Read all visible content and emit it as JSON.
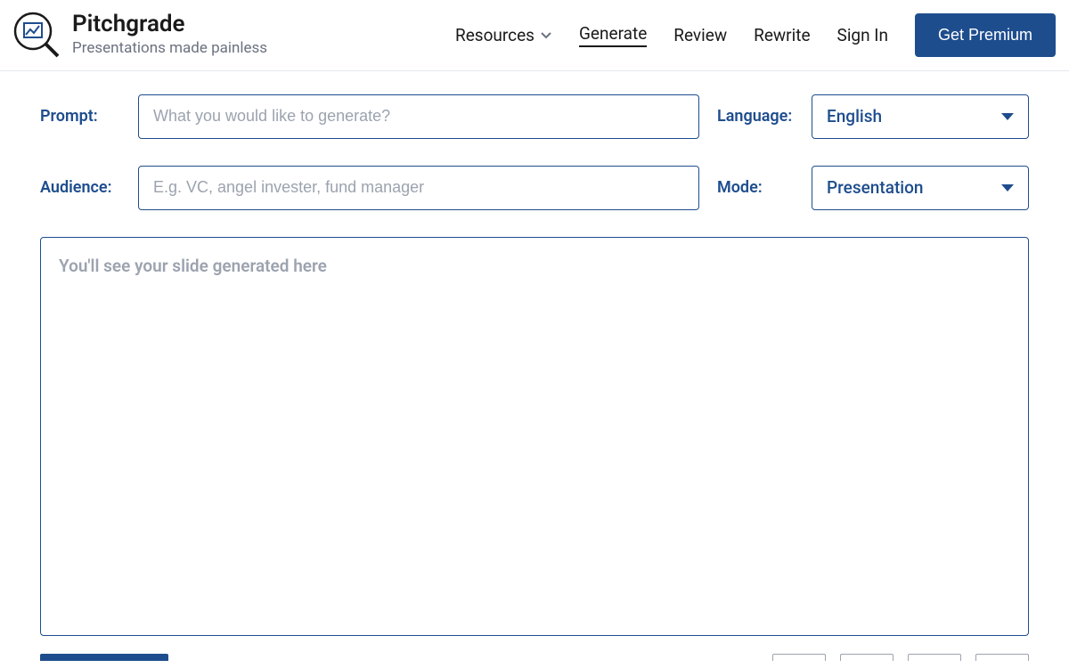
{
  "brand": {
    "title": "Pitchgrade",
    "tagline": "Presentations made painless"
  },
  "nav": {
    "resources": "Resources",
    "generate": "Generate",
    "review": "Review",
    "rewrite": "Rewrite",
    "signin": "Sign In",
    "premium": "Get Premium"
  },
  "form": {
    "prompt_label": "Prompt:",
    "prompt_placeholder": "What you would like to generate?",
    "audience_label": "Audience:",
    "audience_placeholder": "E.g. VC, angel invester, fund manager",
    "language_label": "Language:",
    "language_value": "English",
    "mode_label": "Mode:",
    "mode_value": "Presentation"
  },
  "output": {
    "placeholder": "You'll see your slide generated here"
  }
}
